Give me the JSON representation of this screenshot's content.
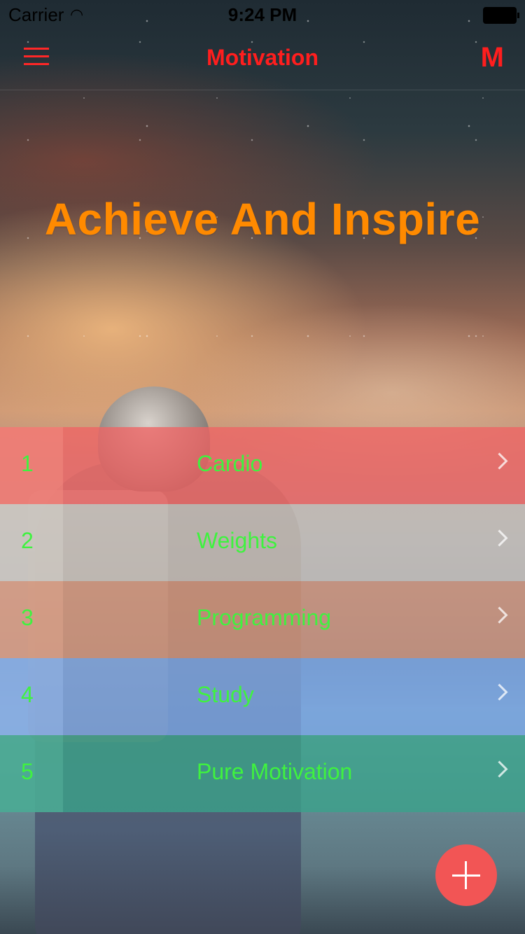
{
  "status_bar": {
    "carrier": "Carrier",
    "wifi_icon": "wifi-icon",
    "time": "9:24 PM",
    "battery_icon": "battery-icon"
  },
  "nav": {
    "menu_icon": "hamburger-menu-icon",
    "title": "Motivation",
    "logo": "M"
  },
  "headline": "Achieve And Inspire",
  "list": {
    "items": [
      {
        "number": "1",
        "label": "Cardio",
        "bg": "#f06464",
        "num_bg": "#f28a80"
      },
      {
        "number": "2",
        "label": "Weights",
        "bg": "#c7c2bc",
        "num_bg": "#d2cdc6"
      },
      {
        "number": "3",
        "label": "Programming",
        "bg": "#d2947a",
        "num_bg": "#dca48c"
      },
      {
        "number": "4",
        "label": "Study",
        "bg": "#7aa6e8",
        "num_bg": "#93b5e6"
      },
      {
        "number": "5",
        "label": "Pure Motivation",
        "bg": "#3aa38a",
        "num_bg": "#56b09a"
      }
    ],
    "chevron_icon": "chevron-right-icon"
  },
  "fab": {
    "icon": "plus-icon",
    "color": "#f25555"
  },
  "colors": {
    "nav_accent": "#ff1e1e",
    "headline": "#ff8a00",
    "list_text": "#3ff23f"
  }
}
